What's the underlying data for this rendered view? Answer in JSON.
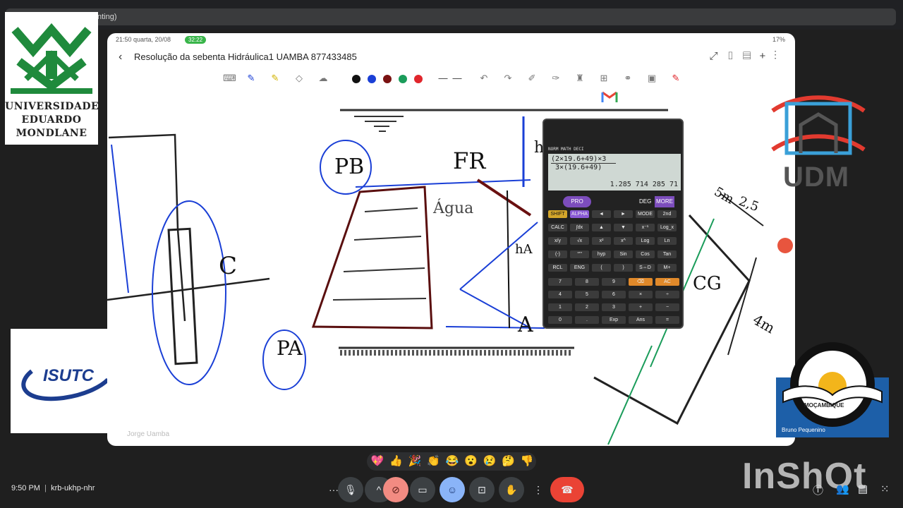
{
  "browser": {
    "tab_title": "nting)"
  },
  "logos": {
    "uem": {
      "line1": "UNIVERSIDADE",
      "line2": "EDUARDO",
      "line3": "MONDLANE"
    },
    "isutc": {
      "name": "ISUTC"
    },
    "udm": {
      "name": "UDM"
    },
    "mocambique": {
      "label": "MOÇAMBIQUE"
    }
  },
  "tablet": {
    "status": {
      "time": "21:50 quarta, 20/08",
      "badge": "32:22",
      "right": "17%"
    },
    "doc_title": "Resolução da sebenta Hidráulica1 UAMBA 877433485",
    "colors": [
      "#111111",
      "#1a3fd6",
      "#7a1212",
      "#1a9c5a",
      "#e0262c"
    ],
    "watermark_name": "Jorge Uamba"
  },
  "drawing": {
    "labels": {
      "pb": "PB",
      "fr": "FR",
      "agua": "Água",
      "ha": "hA",
      "pa": "PA",
      "a": "A",
      "c": "C",
      "cg": "CG",
      "dim_5m": "5m",
      "dim_25": "2,5",
      "dim_4m": "4m",
      "h": "h"
    }
  },
  "calculator": {
    "header": "NORM MATH DECI",
    "expr_num": "(2×19.6+49)×3",
    "expr_den": "3×(19.6+49)",
    "result": "1.285 714 285 71",
    "mode_pro": "PRO",
    "mode_deg": "DEG",
    "mode_more": "MORE",
    "keys": [
      "SHIFT",
      "ALPHA",
      "◄",
      "►",
      "MODE",
      "2nd",
      "CALC",
      "∫dx",
      "▲",
      "▼",
      "x⁻¹",
      "Log_x",
      "x/y",
      "√x",
      "x²",
      "x^",
      "Log",
      "Ln",
      "(-)",
      "°'\"",
      "hyp",
      "Sin",
      "Cos",
      "Tan",
      "RCL",
      "ENG",
      "(",
      ")",
      "S⇔D",
      "M+",
      "7",
      "8",
      "9",
      "⌫",
      "AC",
      "4",
      "5",
      "6",
      "×",
      "÷",
      "1",
      "2",
      "3",
      "+",
      "−",
      "0",
      ".",
      "Exp",
      "Ans",
      "="
    ]
  },
  "participant": {
    "name": "Bruno Pequenino"
  },
  "meeting": {
    "time": "9:50 PM",
    "code": "krb-ukhp-nhr",
    "reactions": [
      "💖",
      "👍",
      "🎉",
      "👏",
      "😂",
      "😮",
      "😢",
      "🤔",
      "👎"
    ]
  },
  "watermark": {
    "inshot": "InShOt"
  }
}
